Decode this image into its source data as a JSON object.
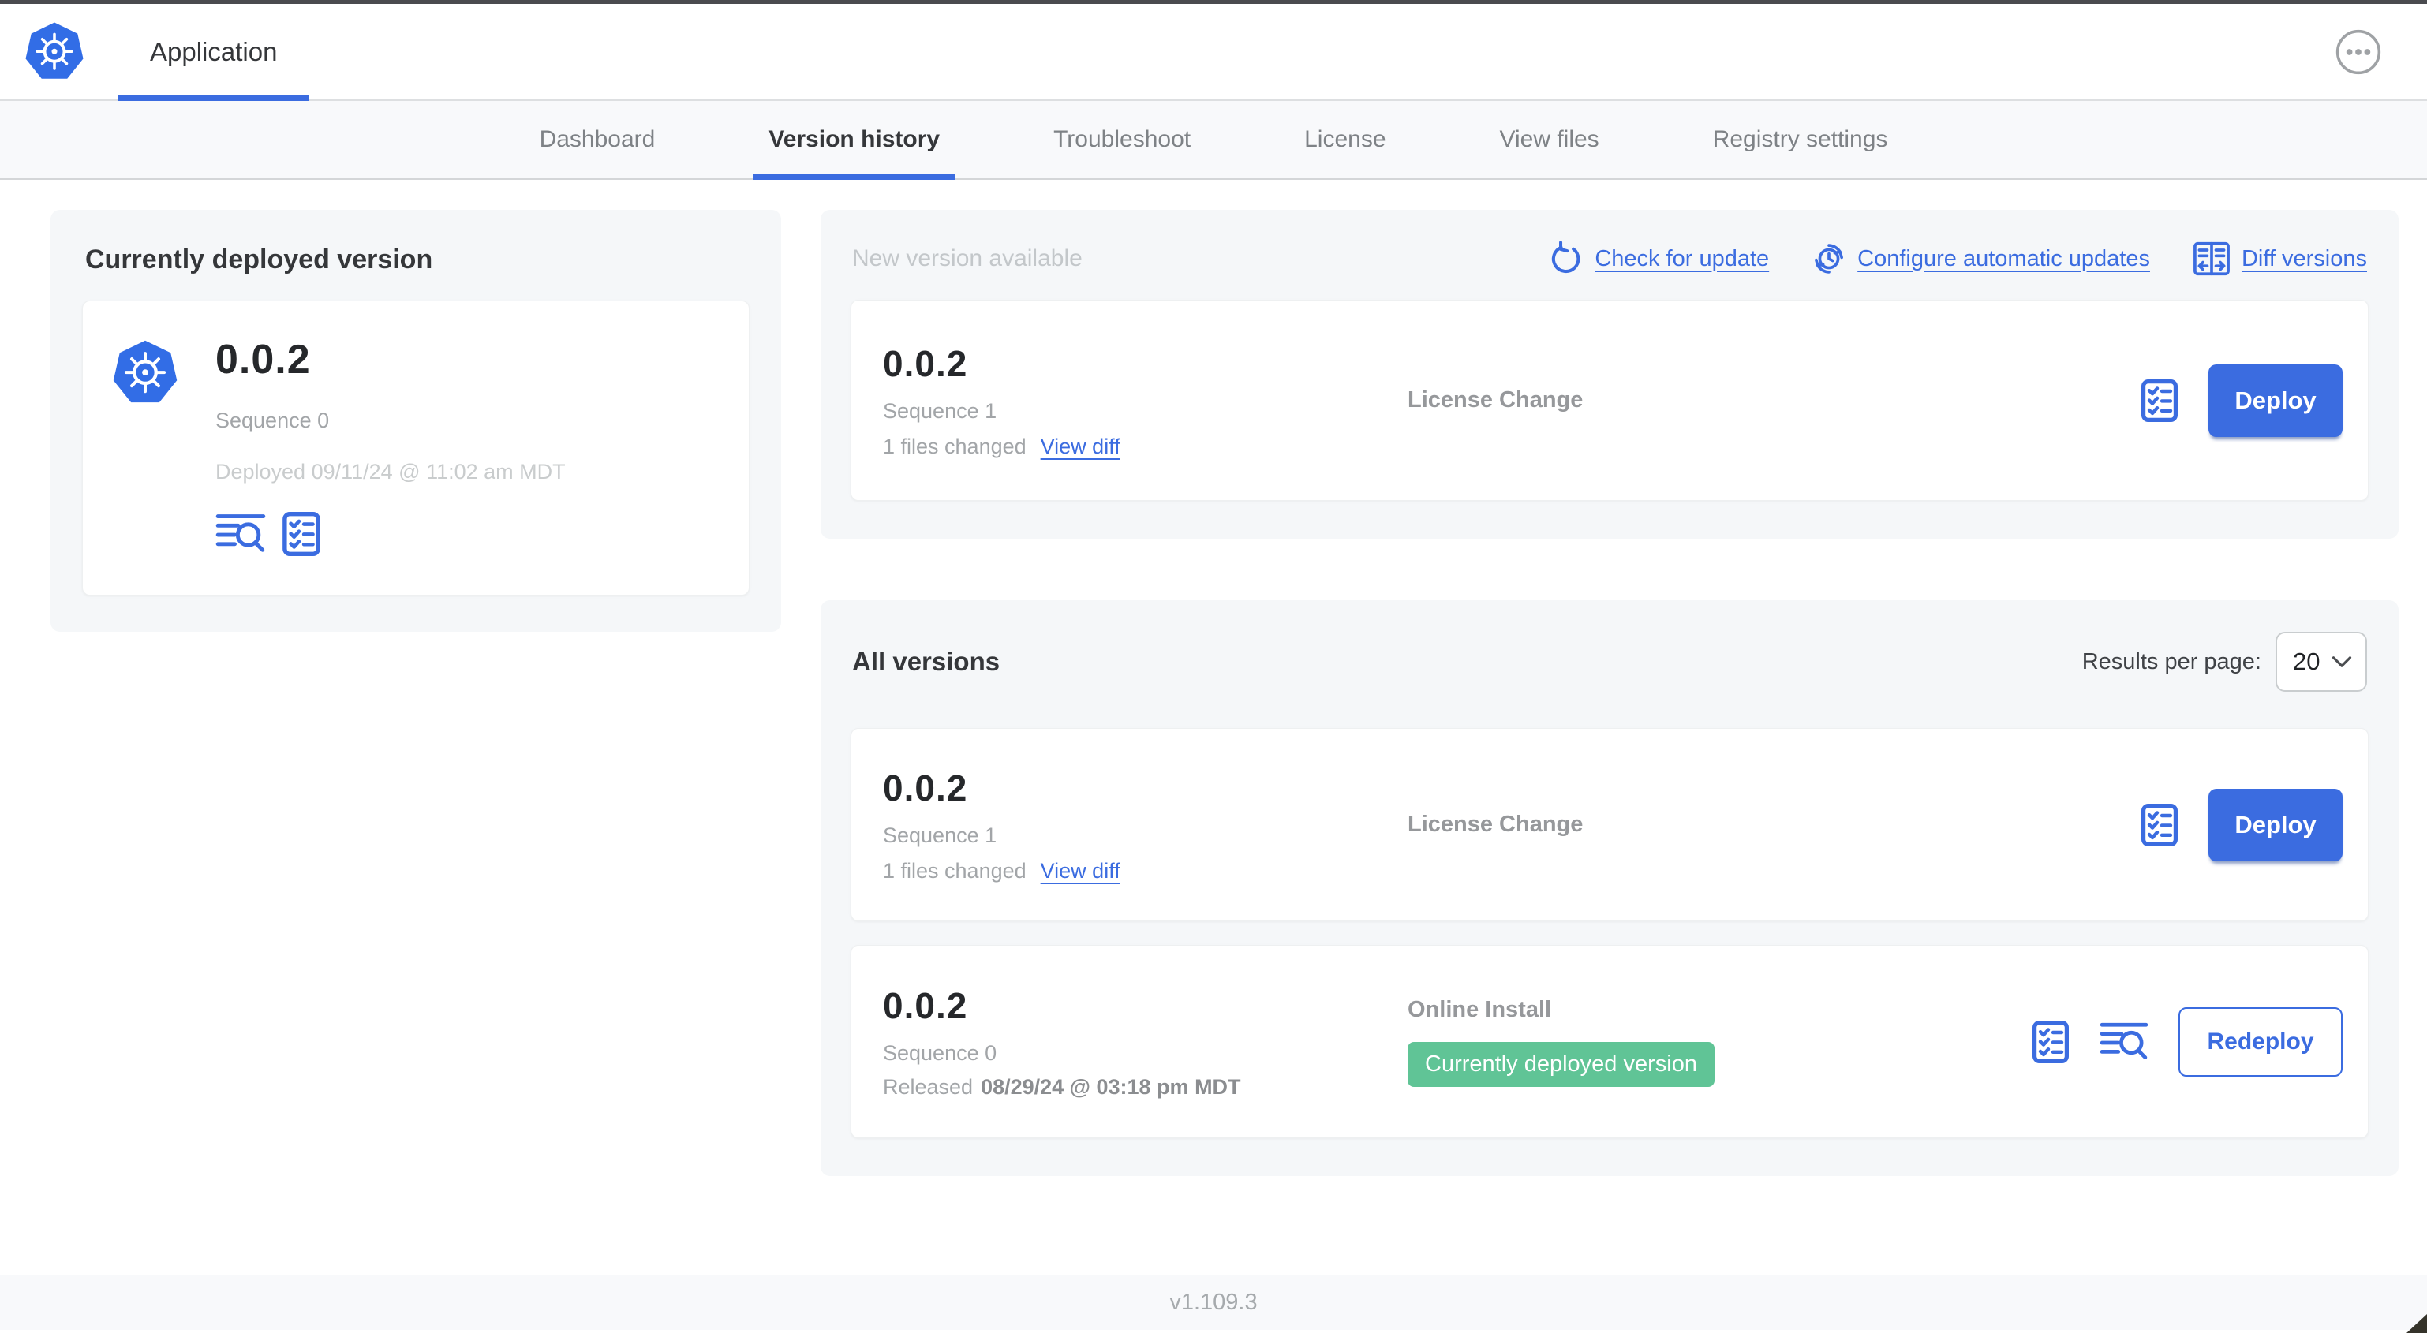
{
  "header": {
    "app_tab": "Application",
    "menu_icon": "ellipsis-icon"
  },
  "nav_tabs": [
    {
      "label": "Dashboard",
      "active": false
    },
    {
      "label": "Version history",
      "active": true
    },
    {
      "label": "Troubleshoot",
      "active": false
    },
    {
      "label": "License",
      "active": false
    },
    {
      "label": "View files",
      "active": false
    },
    {
      "label": "Registry settings",
      "active": false
    }
  ],
  "deployed_card": {
    "title": "Currently deployed version",
    "logo_icon": "kubernetes-logo",
    "version": "0.0.2",
    "sequence": "Sequence 0",
    "deployed_at": "Deployed 09/11/24 @ 11:02 am MDT",
    "icons": [
      "logs-icon",
      "config-checklist-icon"
    ]
  },
  "new_version": {
    "title": "New version available",
    "actions": {
      "check": "Check for update",
      "check_icon": "refresh-icon",
      "auto": "Configure automatic updates",
      "auto_icon": "clock-sync-icon",
      "diff": "Diff versions",
      "diff_icon": "diff-columns-icon"
    },
    "card": {
      "version": "0.0.2",
      "sequence": "Sequence 1",
      "files_changed": "1 files changed",
      "view_diff": "View diff",
      "source": "License Change",
      "config_icon": "config-checklist-icon",
      "deploy": "Deploy"
    }
  },
  "all_versions": {
    "title": "All versions",
    "results_per_page_label": "Results per page:",
    "results_per_page": "20",
    "rows": [
      {
        "version": "0.0.2",
        "sequence": "Sequence 1",
        "files_changed": "1 files changed",
        "view_diff": "View diff",
        "source": "License Change",
        "config_icon": "config-checklist-icon",
        "action": "Deploy"
      },
      {
        "version": "0.0.2",
        "sequence": "Sequence 0",
        "released_label": "Released",
        "released_at": "08/29/24 @ 03:18 pm MDT",
        "source": "Online Install",
        "badge": "Currently deployed version",
        "config_icon": "config-checklist-icon",
        "logs_icon": "logs-icon",
        "action": "Redeploy"
      }
    ]
  },
  "footer": {
    "version": "v1.109.3"
  },
  "colors": {
    "accent_blue": "#3b6ce0",
    "logo_blue": "#326de6",
    "badge_green": "#60c496",
    "panel_gray": "#f5f7f9"
  }
}
